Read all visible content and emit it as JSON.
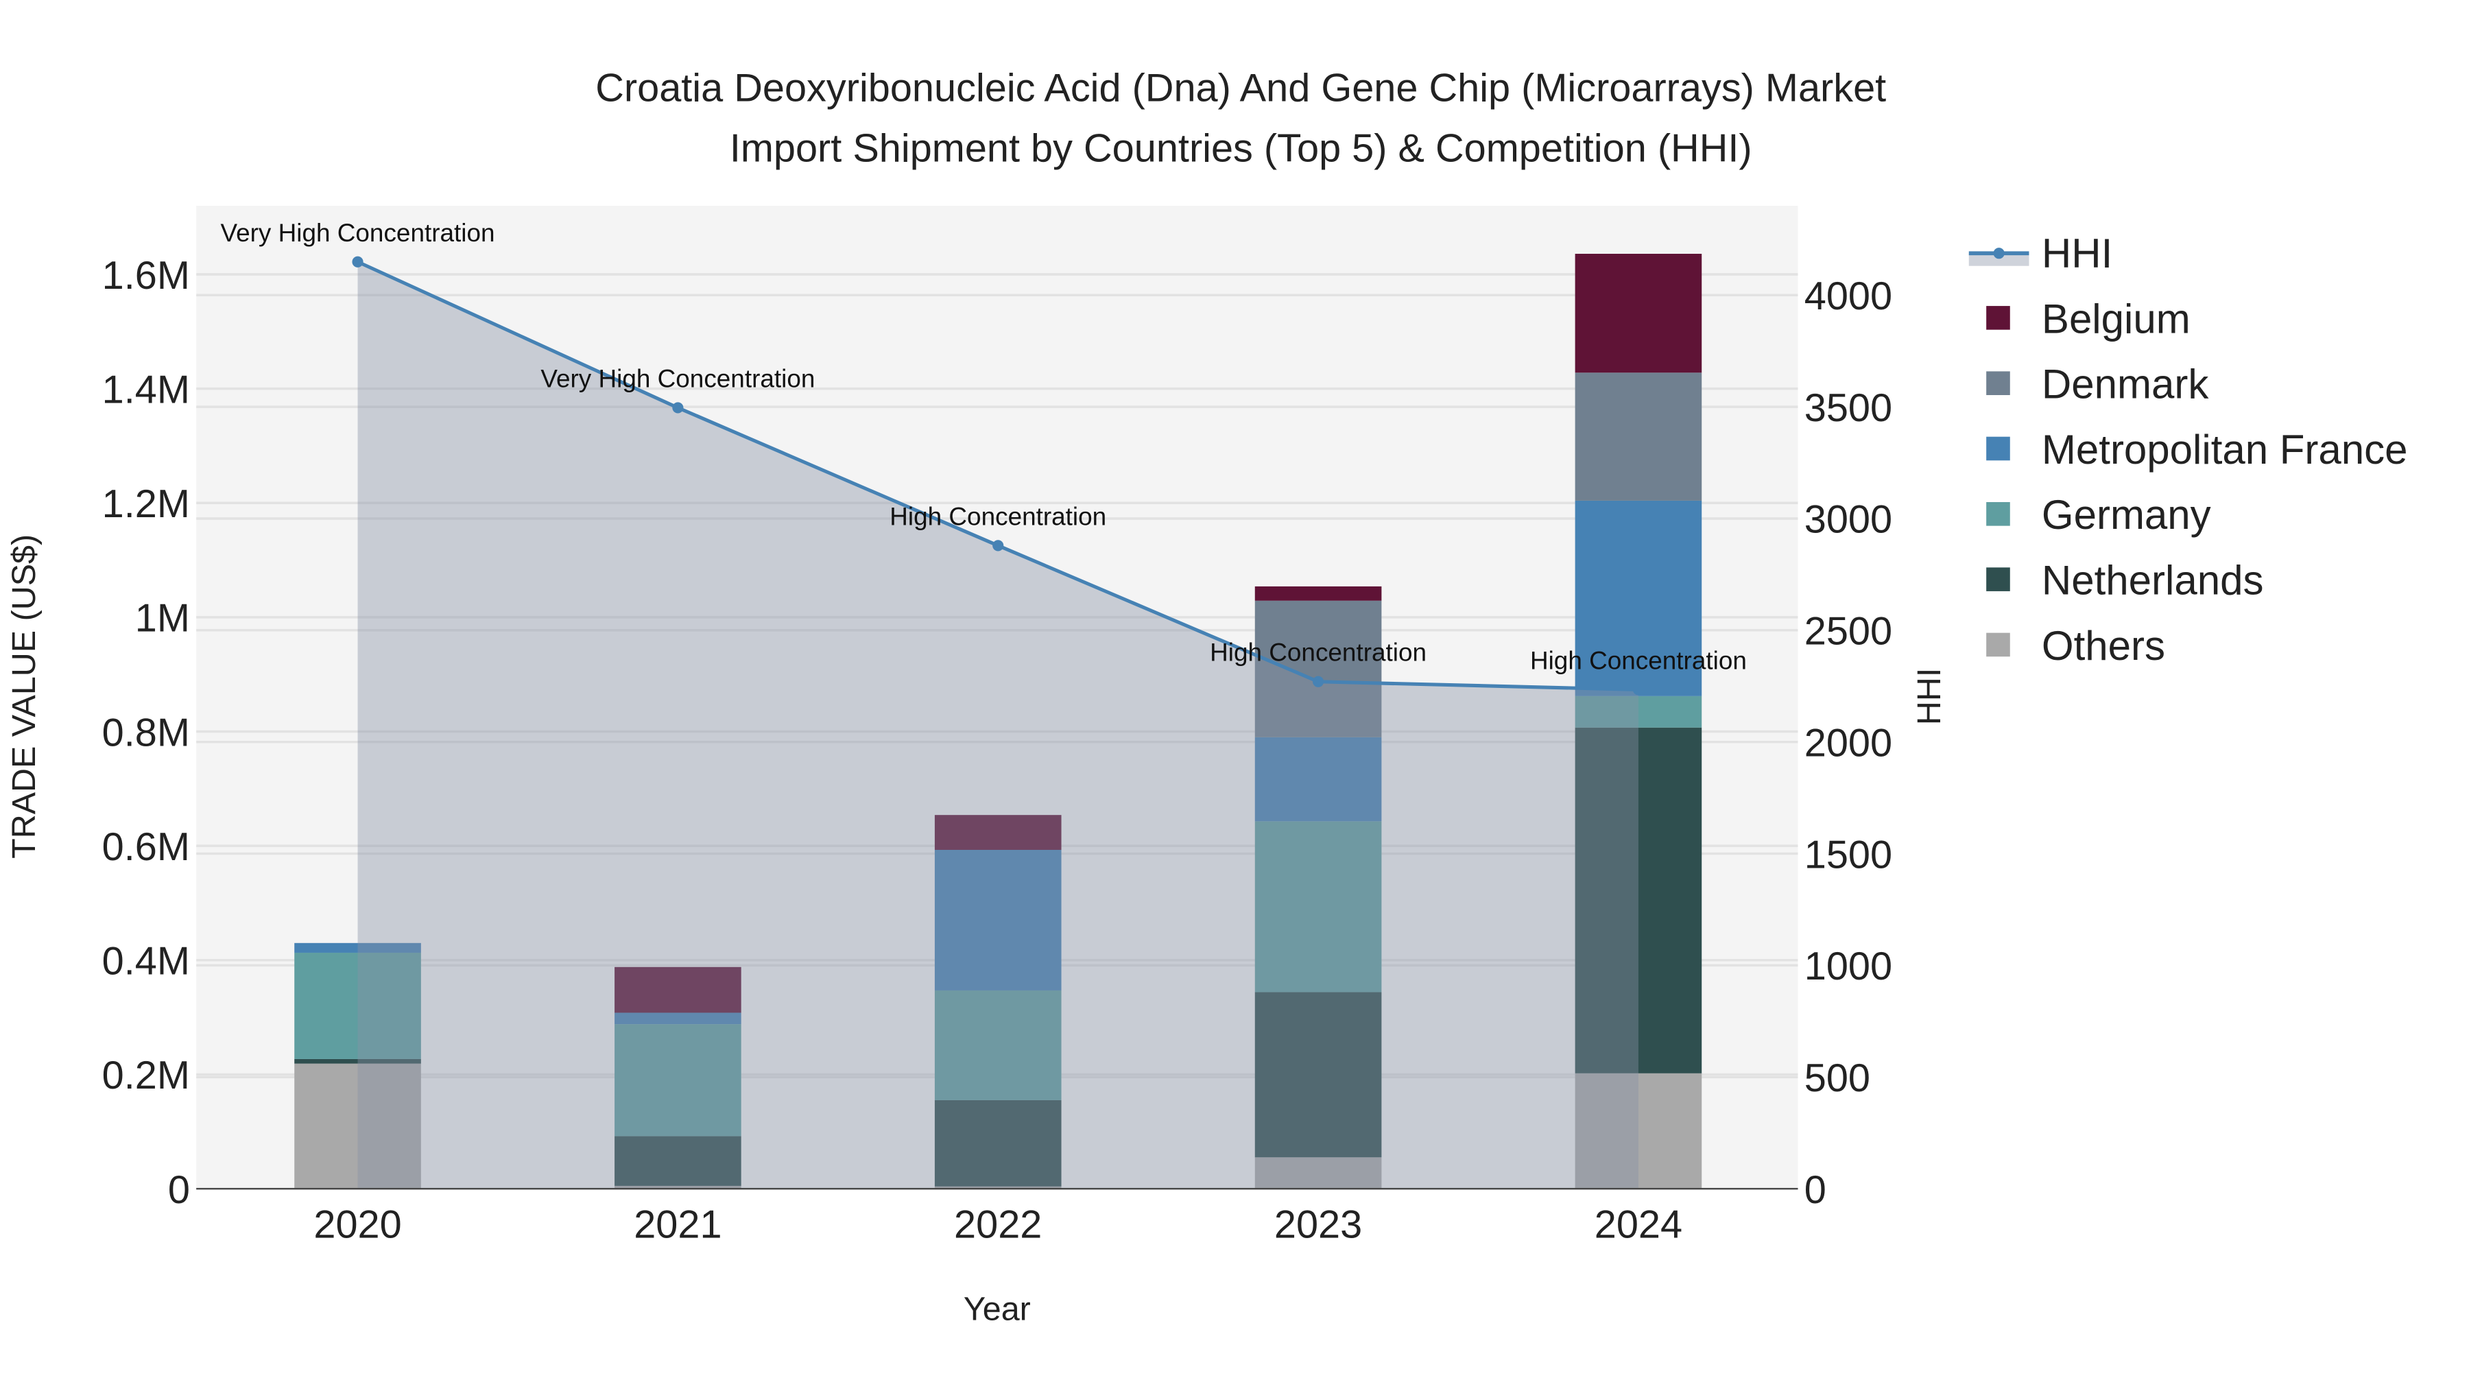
{
  "chart_data": {
    "type": "bar",
    "title_line1": "Croatia Deoxyribonucleic Acid (Dna) And Gene Chip (Microarrays) Market",
    "title_line2": "Import Shipment by Countries (Top 5) & Competition (HHI)",
    "xlabel": "Year",
    "ylabel": "TRADE VALUE (US$)",
    "y2label": "HHI",
    "categories": [
      "2020",
      "2021",
      "2022",
      "2023",
      "2024"
    ],
    "ylim": [
      0,
      1720000
    ],
    "y2lim": [
      0,
      4400
    ],
    "yticks": [
      {
        "v": 0,
        "label": "0"
      },
      {
        "v": 200000,
        "label": "0.2M"
      },
      {
        "v": 400000,
        "label": "0.4M"
      },
      {
        "v": 600000,
        "label": "0.6M"
      },
      {
        "v": 800000,
        "label": "0.8M"
      },
      {
        "v": 1000000,
        "label": "1M"
      },
      {
        "v": 1200000,
        "label": "1.2M"
      },
      {
        "v": 1400000,
        "label": "1.4M"
      },
      {
        "v": 1600000,
        "label": "1.6M"
      }
    ],
    "y2ticks": [
      {
        "v": 0,
        "label": "0"
      },
      {
        "v": 500,
        "label": "500"
      },
      {
        "v": 1000,
        "label": "1000"
      },
      {
        "v": 1500,
        "label": "1500"
      },
      {
        "v": 2000,
        "label": "2000"
      },
      {
        "v": 2500,
        "label": "2500"
      },
      {
        "v": 3000,
        "label": "3000"
      },
      {
        "v": 3500,
        "label": "3500"
      },
      {
        "v": 4000,
        "label": "4000"
      }
    ],
    "stack_order": [
      "Others",
      "Netherlands",
      "Germany",
      "Metropolitan France",
      "Denmark",
      "Belgium"
    ],
    "series": [
      {
        "name": "Belgium",
        "color": "#5f1336",
        "values": [
          0,
          80000,
          61000,
          25000,
          208000
        ]
      },
      {
        "name": "Denmark",
        "color": "#708090",
        "values": [
          0,
          0,
          0,
          239000,
          224000
        ]
      },
      {
        "name": "Metropolitan France",
        "color": "#4682b4",
        "values": [
          17000,
          20000,
          246000,
          147000,
          342000
        ]
      },
      {
        "name": "Germany",
        "color": "#5f9ea0",
        "values": [
          186000,
          196000,
          192000,
          299000,
          55000
        ]
      },
      {
        "name": "Netherlands",
        "color": "#2f4f4f",
        "values": [
          8000,
          87000,
          151000,
          289000,
          605000
        ]
      },
      {
        "name": "Others",
        "color": "#a9a9a9",
        "values": [
          219000,
          5000,
          4000,
          55000,
          202000
        ]
      }
    ],
    "hhi": {
      "name": "HHI",
      "color": "#4682b4",
      "values": [
        4149,
        3496,
        2879,
        2270,
        2234
      ],
      "annotations": [
        "Very High Concentration",
        "Very High Concentration",
        "High Concentration",
        "High Concentration",
        "High Concentration"
      ]
    },
    "legend_order": [
      "HHI",
      "Belgium",
      "Denmark",
      "Metropolitan France",
      "Germany",
      "Netherlands",
      "Others"
    ],
    "legend_position": "right",
    "grid": true
  }
}
